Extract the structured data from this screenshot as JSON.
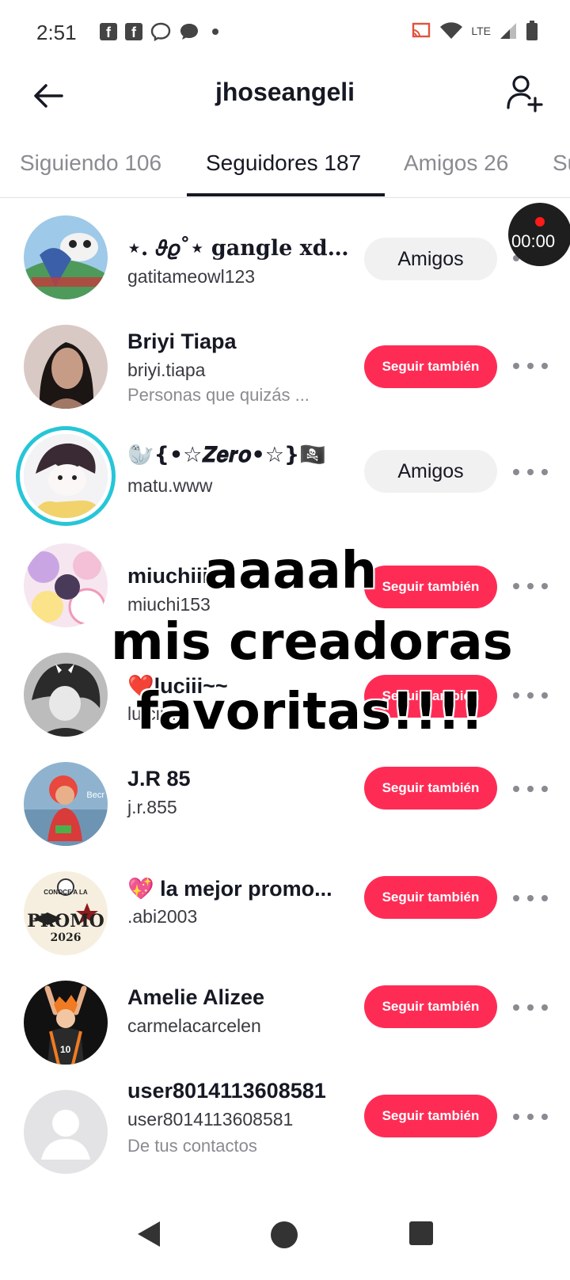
{
  "status": {
    "time": "2:51",
    "network": "LTE",
    "left_icons": [
      "facebook-icon",
      "facebook-icon",
      "messenger-icon",
      "chat-icon"
    ],
    "right_icons": [
      "cast-icon",
      "wifi-icon",
      "signal-icon",
      "battery-icon"
    ]
  },
  "header": {
    "title": "jhoseangeli"
  },
  "tabs": [
    {
      "label": "Siguiendo 106"
    },
    {
      "label": "Seguidores 187"
    },
    {
      "label": "Amigos 26"
    },
    {
      "label": "Su"
    }
  ],
  "recording": {
    "time": "00:00"
  },
  "overlay": {
    "line1": "aaaah",
    "line2": "mis creadoras",
    "line3": "favoritas!!!!"
  },
  "users": [
    {
      "name": "⋆. 𝜗𝜚˚⋆ 𝐠𝐚𝐧𝐠𝐥𝐞 𝐱𝐝⋆. 𝜗𝜚",
      "handle": "gatitameowl123",
      "sub": "",
      "button": "Amigos",
      "type": "friends"
    },
    {
      "name": "Briyi Tiapa",
      "handle": "briyi.tiapa",
      "sub": "Personas que quizás ...",
      "button": "Seguir también",
      "type": "follow"
    },
    {
      "name": "🦭{•☆𝒁𝒆𝒓𝒐•☆}🏴‍☠️",
      "handle": "matu.www",
      "sub": "",
      "button": "Amigos",
      "type": "friends"
    },
    {
      "name": "miuchiii",
      "handle": "miuchi153",
      "sub": "",
      "button": "Seguir también",
      "type": "follow"
    },
    {
      "name": "❤️luciii~~",
      "handle": "lu.ciiiii",
      "sub": "",
      "button": "Seguir también",
      "type": "follow"
    },
    {
      "name": "J.R 85",
      "handle": "j.r.855",
      "sub": "",
      "button": "Seguir también",
      "type": "follow"
    },
    {
      "name": "💖 la mejor promo...",
      "handle": ".abi2003",
      "sub": "",
      "button": "Seguir también",
      "type": "follow"
    },
    {
      "name": "Amelie Alizee",
      "handle": "carmelacarcelen",
      "sub": "",
      "button": "Seguir también",
      "type": "follow"
    },
    {
      "name": "user8014113608581",
      "handle": "user8014113608581",
      "sub": "De tus contactos",
      "button": "Seguir también",
      "type": "follow"
    }
  ],
  "avatar_badges": {
    "promo_line1": "CONOCE A LA",
    "promo_line2": "PROMO",
    "promo_line3": "2026",
    "jr_text": "Becr",
    "jersey": "10"
  }
}
